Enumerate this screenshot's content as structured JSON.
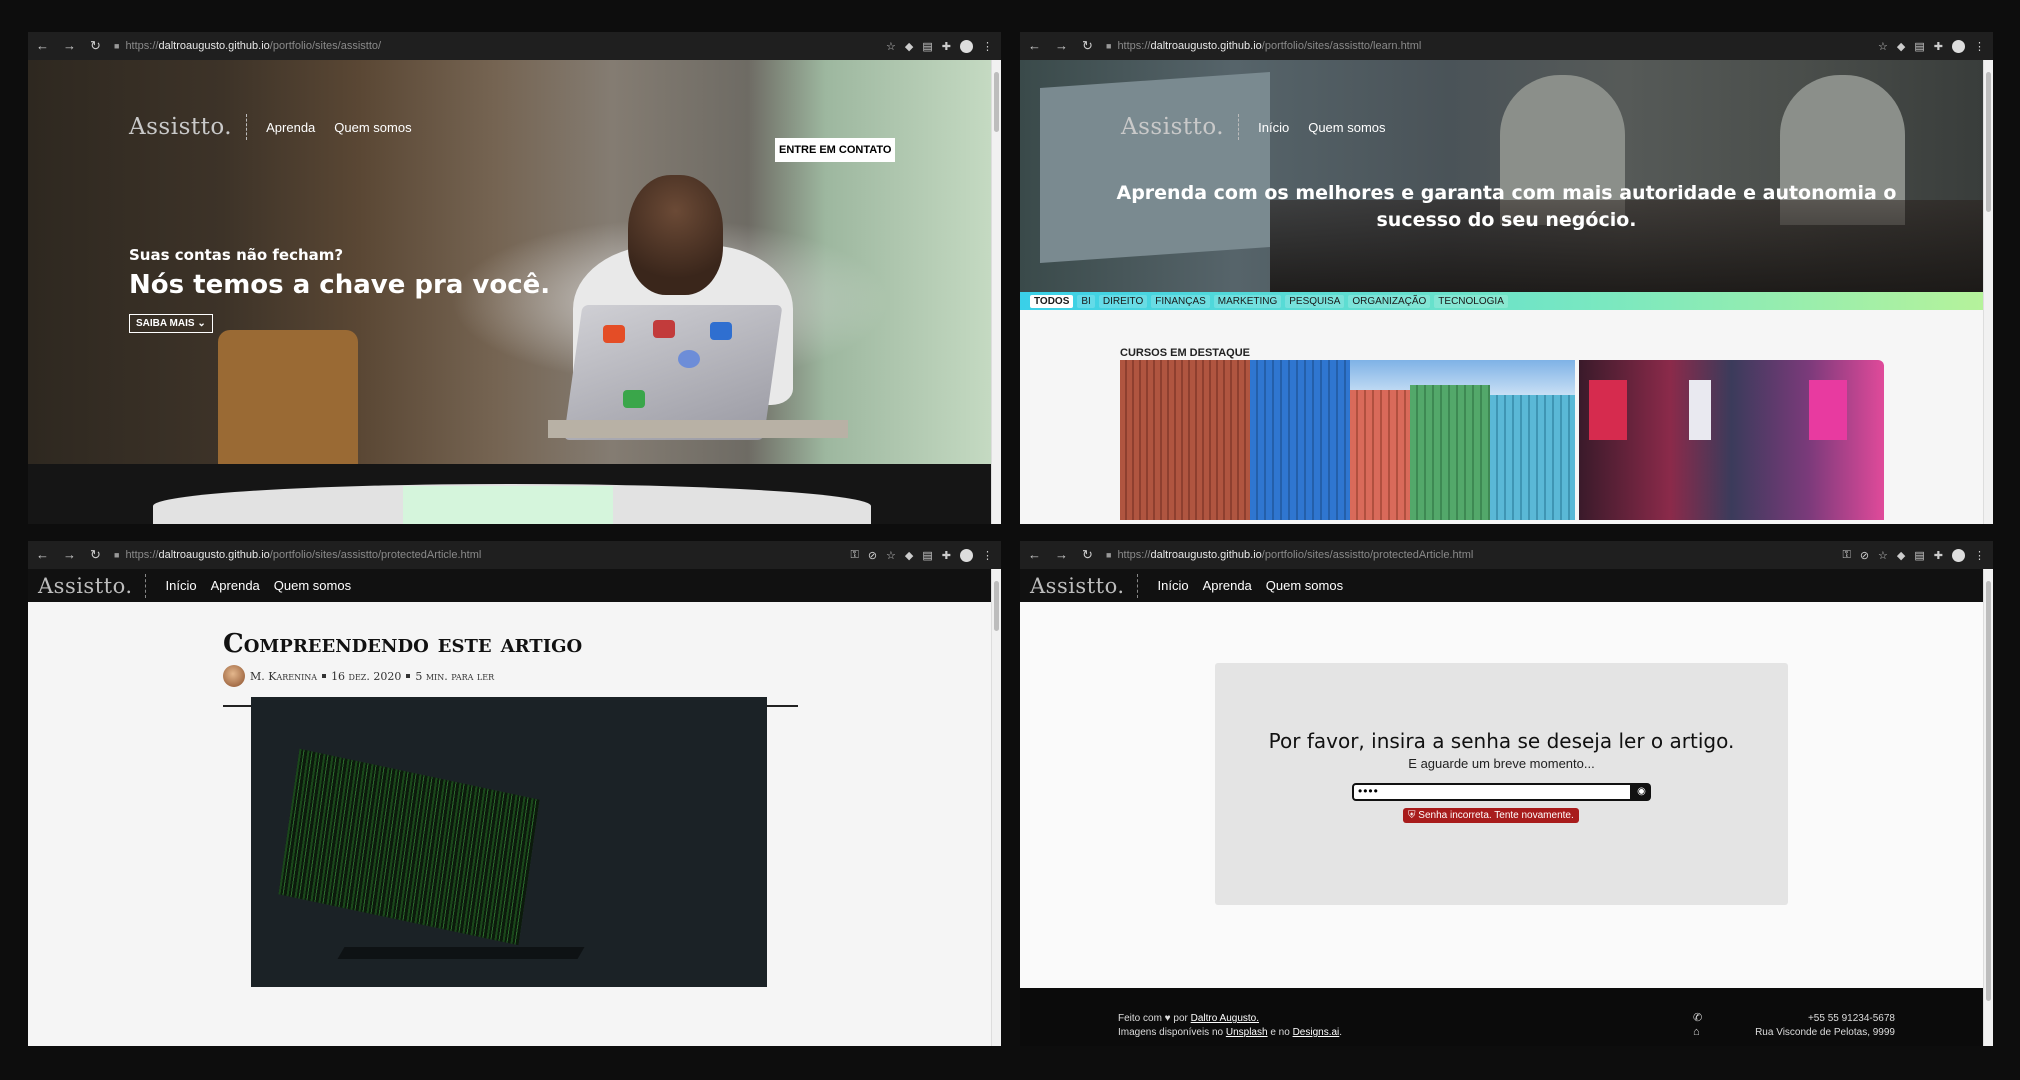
{
  "windows": [
    {
      "url_prefix": "https://",
      "url_host": "daltroaugusto.github.io",
      "url_path": "/portfolio/sites/assistto/",
      "logo": "Assistto.",
      "nav": [
        "Aprenda",
        "Quem somos"
      ],
      "cta": "ENTRE EM CONTATO",
      "hero_small": "Suas contas não fecham?",
      "hero_big": "Nós temos a chave pra você.",
      "saiba_mais": "SAIBA MAIS"
    },
    {
      "url_prefix": "https://",
      "url_host": "daltroaugusto.github.io",
      "url_path": "/portfolio/sites/assistto/learn.html",
      "logo": "Assistto.",
      "nav": [
        "Início",
        "Quem somos"
      ],
      "headline": "Aprenda com os melhores e garanta com mais autoridade e autonomia o sucesso do seu negócio.",
      "categories": [
        "TODOS",
        "BI",
        "DIREITO",
        "FINANÇAS",
        "MARKETING",
        "PESQUISA",
        "ORGANIZAÇÃO",
        "TECNOLOGIA"
      ],
      "featured_label": "CURSOS EM DESTAQUE"
    },
    {
      "url_prefix": "https://",
      "url_host": "daltroaugusto.github.io",
      "url_path": "/portfolio/sites/assistto/protectedArticle.html",
      "logo": "Assistto.",
      "nav": [
        "Início",
        "Aprenda",
        "Quem somos"
      ],
      "title": "Compreendendo este artigo",
      "author": "M. Karenina",
      "date": "16 dez. 2020",
      "read_time": "5 min. para ler"
    },
    {
      "url_prefix": "https://",
      "url_host": "daltroaugusto.github.io",
      "url_path": "/portfolio/sites/assistto/protectedArticle.html",
      "logo": "Assistto.",
      "nav": [
        "Início",
        "Aprenda",
        "Quem somos"
      ],
      "modal_title": "Por favor, insira a senha se deseja ler o artigo.",
      "modal_sub": "E aguarde um breve momento...",
      "password_value": "••••",
      "error": "Senha incorreta. Tente novamente.",
      "footer_line1_pre": "Feito com ♥ por ",
      "footer_author": "Daltro Augusto.",
      "footer_line2_pre": "Imagens disponíveis no ",
      "footer_unsplash": "Unsplash",
      "footer_mid": " e no ",
      "footer_designs": "Designs.ai",
      "footer_end": ".",
      "phone": "+55 55 91234-5678",
      "address": "Rua Visconde de Pelotas, 9999"
    }
  ],
  "icons": {
    "back": "←",
    "forward": "→",
    "reload": "↻",
    "star": "☆",
    "key": "⚿",
    "menu": "⋮",
    "puzzle": "✚"
  }
}
